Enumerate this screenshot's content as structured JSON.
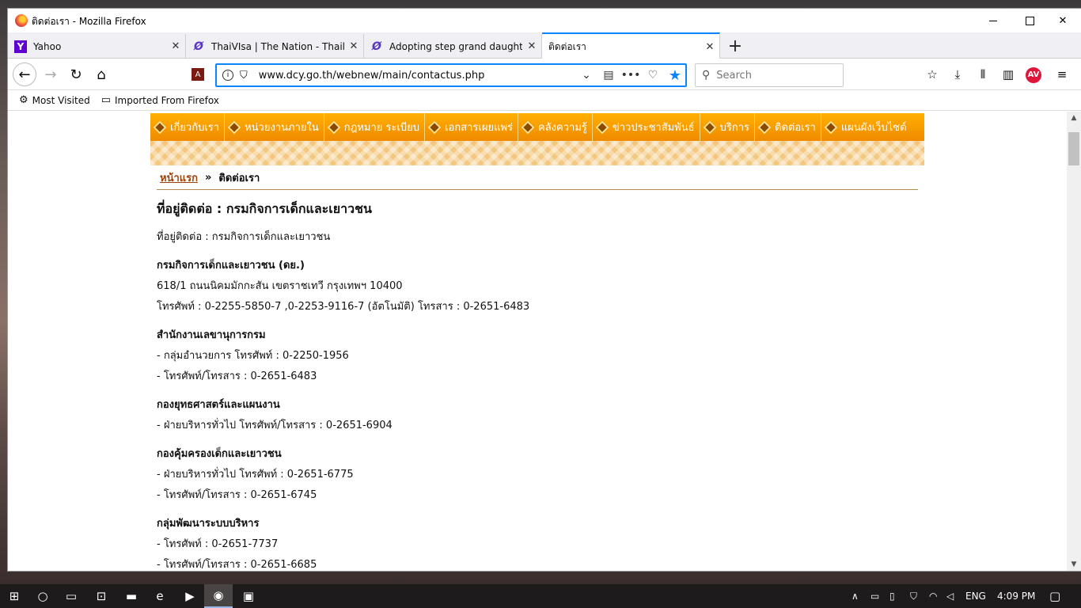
{
  "window": {
    "title": "ติดต่อเรา - Mozilla Firefox"
  },
  "tabs": [
    {
      "label": "Yahoo",
      "icon": "yahoo-icon"
    },
    {
      "label": "ThaiVIsa | The Nation - Thailan",
      "icon": "nation-icon"
    },
    {
      "label": "Adopting step grand daughter",
      "icon": "nation-icon"
    },
    {
      "label": "ติดต่อเรา",
      "icon": "none",
      "active": true
    }
  ],
  "navbar": {
    "url": "www.dcy.go.th/webnew/main/contactus.php",
    "search_placeholder": "Search"
  },
  "bookmarks": [
    {
      "label": "Most Visited",
      "icon": "gear-icon"
    },
    {
      "label": "Imported From Firefox",
      "icon": "folder-icon"
    }
  ],
  "site": {
    "menu": [
      "เกี่ยวกับเรา",
      "หน่วยงานภายใน",
      "กฎหมาย ระเบียบ",
      "เอกสารเผยแพร่",
      "คลังความรู้",
      "ข่าวประชาสัมพันธ์",
      "บริการ",
      "ติดต่อเรา",
      "แผนผังเว็บไซต์"
    ],
    "breadcrumb": {
      "home": "หน้าแรก",
      "separator": "»",
      "current": "ติดต่อเรา"
    },
    "heading": "ที่อยู่ติดต่อ : กรมกิจการเด็กและเยาวชน",
    "intro": "ที่อยู่ติดต่อ : กรมกิจการเด็กและเยาวชน",
    "sections": [
      {
        "title": "กรมกิจการเด็กและเยาวชน (ดย.)",
        "lines": [
          "618/1 ถนนนิคมมักกะสัน เขตราชเทวี กรุงเทพฯ 10400",
          "โทรศัพท์ : 0-2255-5850-7 ,0-2253-9116-7 (อัตโนมัติ) โทรสาร : 0-2651-6483"
        ]
      },
      {
        "title": "สำนักงานเลขานุการกรม",
        "lines": [
          "- กลุ่มอำนวยการ โทรศัพท์ : 0-2250-1956",
          "- โทรศัพท์/โทรสาร : 0-2651-6483"
        ]
      },
      {
        "title": "กองยุทธศาสตร์และแผนงาน",
        "lines": [
          "- ฝ่ายบริหารทั่วไป โทรศัพท์/โทรสาร : 0-2651-6904"
        ]
      },
      {
        "title": "กองคุ้มครองเด็กและเยาวชน",
        "lines": [
          "- ฝ่ายบริหารทั่วไป โทรศัพท์ : 0-2651-6775",
          "- โทรศัพท์/โทรสาร : 0-2651-6745"
        ]
      },
      {
        "title": "กลุ่มพัฒนาระบบบริหาร",
        "lines": [
          "- โทรศัพท์ : 0-2651-7737",
          "- โทรศัพท์/โทรสาร : 0-2651-6685"
        ]
      }
    ]
  },
  "taskbar": {
    "language": "ENG",
    "time": "4:09 PM"
  },
  "colors": {
    "menu_orange": "#f5a000",
    "accent_blue": "#0a84ff",
    "breadcrumb_link": "#a0430a"
  }
}
